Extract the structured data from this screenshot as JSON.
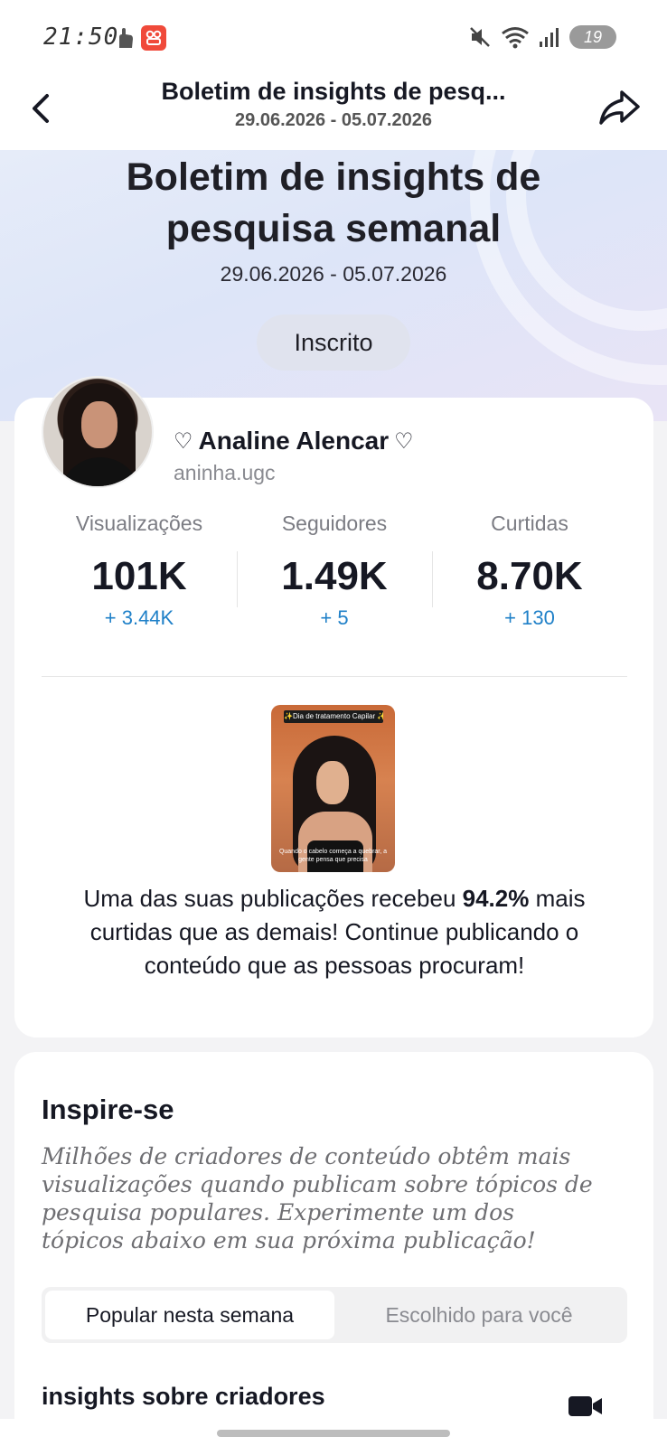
{
  "status_bar": {
    "time": "21:50",
    "battery": "19",
    "icons": [
      "gesture-icon",
      "app-badge-icon",
      "mute-icon",
      "wifi-icon",
      "signal-icon",
      "battery-icon"
    ]
  },
  "navbar": {
    "title": "Boletim de insights de pesq...",
    "subtitle": "29.06.2026 - 05.07.2026",
    "back_icon": "chevron-left-icon",
    "share_icon": "share-arrow-icon"
  },
  "hero": {
    "title": "Boletim de insights de pesquisa semanal",
    "dates": "29.06.2026 - 05.07.2026",
    "subscribe_label": "Inscrito"
  },
  "profile": {
    "display_name": "Analine Alencar",
    "heart_left": "♡",
    "heart_right": "♡",
    "username": "aninha.ugc",
    "stats": [
      {
        "label": "Visualizações",
        "value": "101K",
        "delta": "+ 3.44K"
      },
      {
        "label": "Seguidores",
        "value": "1.49K",
        "delta": "+ 5"
      },
      {
        "label": "Curtidas",
        "value": "8.70K",
        "delta": "+ 130"
      }
    ]
  },
  "post": {
    "caption_top": "✨Dia de tratamento Capilar ✨",
    "caption_bottom": "Quando o cabelo começa a quebrar, a gente pensa que precisa"
  },
  "insight": {
    "text_before": "Uma das suas publicações recebeu ",
    "highlight": "94.2%",
    "text_after": " mais curtidas que as demais! Continue publicando o conteúdo que as pessoas procuram!"
  },
  "inspire": {
    "title": "Inspire-se",
    "description": "Milhões de criadores de conteúdo obtêm mais visualizações quando publicam sobre tópicos de pesquisa populares. Experimente um dos tópicos abaixo em sua próxima publicação!",
    "tabs": [
      {
        "label": "Popular nesta semana",
        "active": true
      },
      {
        "label": "Escolhido para você",
        "active": false
      }
    ],
    "section_heading": "insights sobre criadores",
    "video_icon": "video-camera-icon"
  },
  "colors": {
    "accent_blue": "#1f80c8",
    "text_primary": "#161823",
    "text_secondary": "#8a8b91",
    "hero_bg": "#dde5f8"
  }
}
